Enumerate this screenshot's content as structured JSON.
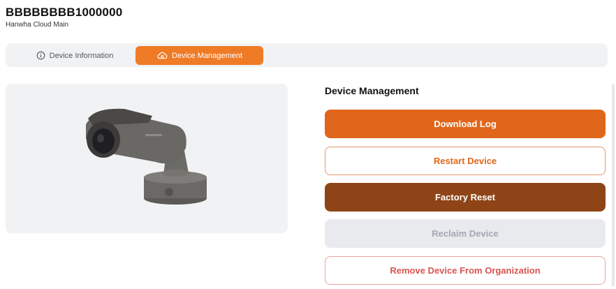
{
  "device": {
    "title": "BBBBBBBB1000000",
    "subtitle": "Hanwha Cloud Main"
  },
  "tabs": [
    {
      "label": "Device Information",
      "icon": "info-icon",
      "active": false
    },
    {
      "label": "Device Management",
      "icon": "cloud-gear-icon",
      "active": true
    }
  ],
  "management": {
    "title": "Device Management",
    "buttons": {
      "download_log": "Download Log",
      "restart": "Restart Device",
      "factory_reset": "Factory Reset",
      "reclaim": "Reclaim Device",
      "remove": "Remove Device From Organization"
    }
  },
  "colors": {
    "accent": "#f07b26",
    "primary_button": "#e0661b",
    "danger_dark": "#8f4417",
    "disabled_bg": "#e9eaee",
    "danger_text": "#d9534f"
  }
}
